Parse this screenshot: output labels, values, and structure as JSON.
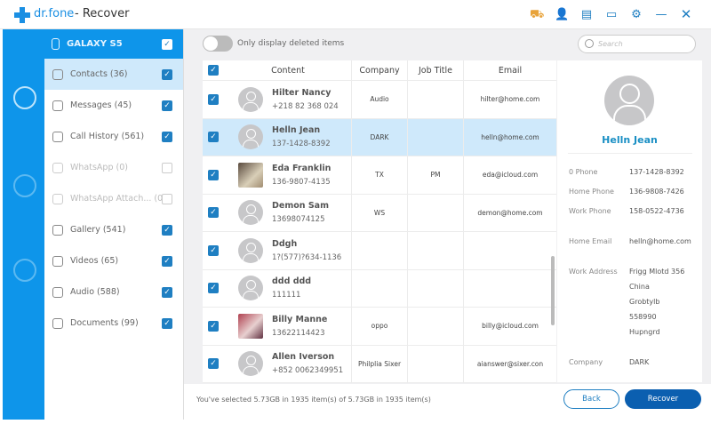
{
  "app": {
    "brand": "dr.fone",
    "title": "- Recover"
  },
  "titlebar_icons": [
    "cart-icon",
    "user-icon",
    "inbox-icon",
    "feedback-icon",
    "settings-icon",
    "minimize-icon",
    "close-icon"
  ],
  "device": {
    "name": "GALAXY S5",
    "checked": true
  },
  "categories": [
    {
      "label": "Contacts (36)",
      "checked": true,
      "active": true,
      "disabled": false
    },
    {
      "label": "Messages (45)",
      "checked": true,
      "active": false,
      "disabled": false
    },
    {
      "label": "Call History (561)",
      "checked": true,
      "active": false,
      "disabled": false
    },
    {
      "label": "WhatsApp (0)",
      "checked": false,
      "active": false,
      "disabled": true
    },
    {
      "label": "WhatsApp Attach...  (0)",
      "checked": false,
      "active": false,
      "disabled": true
    },
    {
      "label": "Gallery (541)",
      "checked": true,
      "active": false,
      "disabled": false
    },
    {
      "label": "Videos (65)",
      "checked": true,
      "active": false,
      "disabled": false
    },
    {
      "label": "Audio (588)",
      "checked": true,
      "active": false,
      "disabled": false
    },
    {
      "label": "Documents (99)",
      "checked": true,
      "active": false,
      "disabled": false
    }
  ],
  "toolbar": {
    "toggle_label": "Only display deleted items",
    "toggle_on": false,
    "search_placeholder": "Search"
  },
  "table": {
    "headers": [
      "Content",
      "Company",
      "Job Title",
      "Email"
    ],
    "rows": [
      {
        "name": "Hilter Nancy",
        "phone": "+218 82 368 024",
        "company": "Audio",
        "job": "",
        "email": "hilter@home.com",
        "avatar": "default",
        "selected": false
      },
      {
        "name": "Helln Jean",
        "phone": "137-1428-8392",
        "company": "DARK",
        "job": "",
        "email": "helln@home.com",
        "avatar": "default",
        "selected": true
      },
      {
        "name": "Eda Franklin",
        "phone": "136-9807-4135",
        "company": "TX",
        "job": "PM",
        "email": "eda@icloud.com",
        "avatar": "photo",
        "selected": false
      },
      {
        "name": "Demon Sam",
        "phone": "13698074125",
        "company": "WS",
        "job": "",
        "email": "demon@home.com",
        "avatar": "default",
        "selected": false
      },
      {
        "name": "Ddgh",
        "phone": "1?(577)?634-1136",
        "company": "",
        "job": "",
        "email": "",
        "avatar": "default",
        "selected": false
      },
      {
        "name": "ddd ddd",
        "phone": "111111",
        "company": "",
        "job": "",
        "email": "",
        "avatar": "default",
        "selected": false
      },
      {
        "name": "Billy Manne",
        "phone": "13622114423",
        "company": "oppo",
        "job": "",
        "email": "billy@icloud.com",
        "avatar": "photo2",
        "selected": false
      },
      {
        "name": "Allen Iverson",
        "phone": "+852 0062349951",
        "company": "Philplia Sixer",
        "job": "",
        "email": "aianswer@sixer.con",
        "avatar": "default",
        "selected": false
      }
    ]
  },
  "detail": {
    "name": "Helln Jean",
    "fields": [
      {
        "label": "0 Phone",
        "value": [
          "137-1428-8392"
        ]
      },
      {
        "label": "Home Phone",
        "value": [
          "136-9808-7426"
        ]
      },
      {
        "label": "Work Phone",
        "value": [
          "158-0522-4736"
        ]
      },
      {
        "label": "Home Email",
        "value": [
          "helln@home.com"
        ]
      },
      {
        "label": "Work Address",
        "value": [
          "Frigg Mlotd 356",
          "China",
          "Grobtylb",
          "558990",
          "Hupngrd"
        ]
      },
      {
        "label": "Company",
        "value": [
          "DARK"
        ]
      }
    ]
  },
  "footer": {
    "status": "You've selected 5.73GB in 1935 item(s) of 5.73GB in 1935 item(s)",
    "back": "Back",
    "recover": "Recover"
  }
}
